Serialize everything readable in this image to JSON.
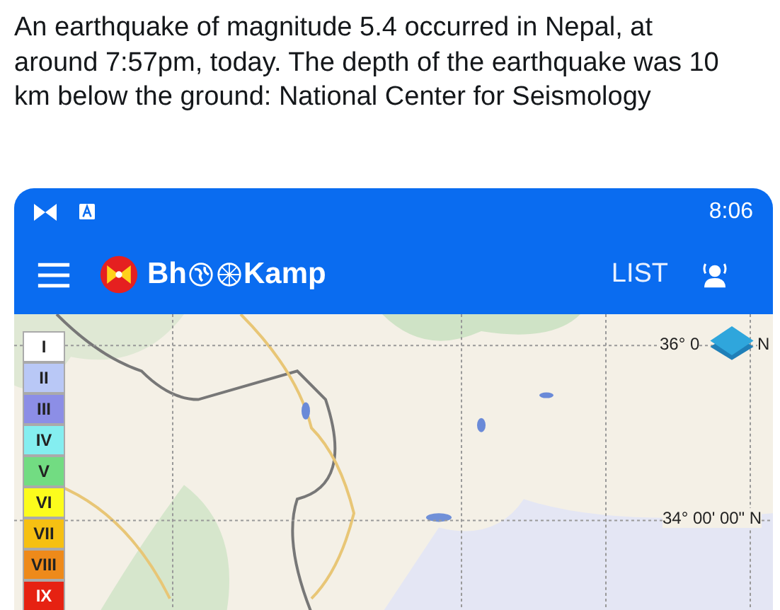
{
  "post": {
    "text": "An earthquake of magnitude 5.4 occurred in Nepal, at around 7:57pm, today. The depth of the earthquake was 10 km below the ground: National Center for Seismology"
  },
  "status_bar": {
    "time": "8:06"
  },
  "app_bar": {
    "logo_text_start": "Bh",
    "logo_text_end": "Kamp",
    "list_button": "LIST"
  },
  "map": {
    "kind": "picture",
    "latitude_labels": [
      {
        "text": "36° 0",
        "suffix": "N"
      },
      {
        "text": "34° 00' 00\" N"
      }
    ],
    "intensity_legend": [
      {
        "label": "I",
        "color": "#ffffff"
      },
      {
        "label": "II",
        "color": "#b9c8f6"
      },
      {
        "label": "III",
        "color": "#8c8ee6"
      },
      {
        "label": "IV",
        "color": "#84eef0"
      },
      {
        "label": "V",
        "color": "#72dc82"
      },
      {
        "label": "VI",
        "color": "#fcfc1c"
      },
      {
        "label": "VII",
        "color": "#f6c012"
      },
      {
        "label": "VIII",
        "color": "#ee8a1a"
      },
      {
        "label": "IX",
        "color": "#e62212"
      }
    ]
  }
}
